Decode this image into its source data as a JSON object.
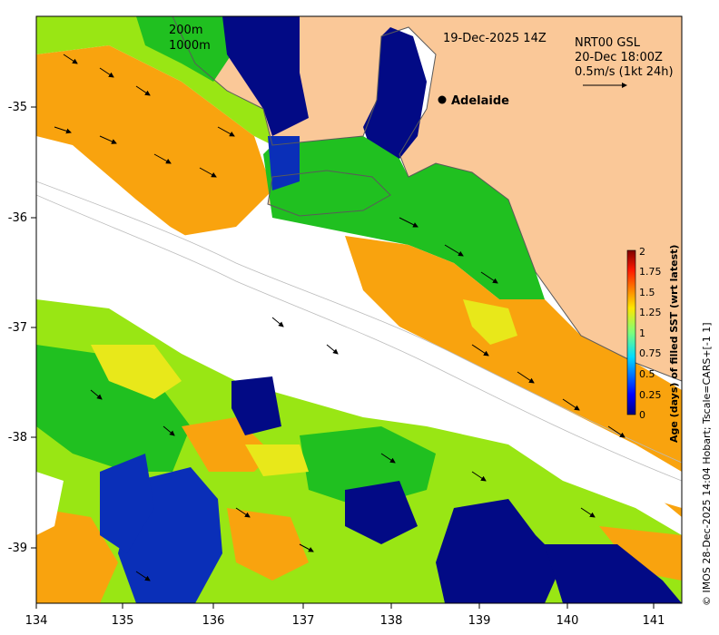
{
  "map": {
    "date_label": "19-Dec-2025 14Z",
    "product_line1": "NRT00 GSL",
    "product_line2": "20-Dec 18:00Z",
    "product_line3": "0.5m/s (1kt 24h)",
    "depth_label1": "200m",
    "depth_label2": "1000m",
    "city": "Adelaide",
    "credit": "© IMOS 28-Dec-2025 14:04 Hobart; Tscale=CARS+[-1 1]",
    "colors": {
      "land": "#fac898",
      "no_data": "#ffffff",
      "orange": "#f9a30e",
      "lime": "#99e614",
      "green": "#20c020",
      "blue": "#0a2fb8",
      "navy": "#020a85",
      "yellow": "#e8e81a"
    }
  },
  "axes": {
    "x_ticks": [
      "134",
      "135",
      "136",
      "137",
      "138",
      "139",
      "140",
      "141"
    ],
    "y_ticks": [
      "-35",
      "-36",
      "-37",
      "-38",
      "-39"
    ]
  },
  "colorbar": {
    "label": "Age (days) of filled SST (wrt latest)",
    "ticks": [
      "0",
      "0.25",
      "0.5",
      "0.75",
      "1",
      "1.25",
      "1.5",
      "1.75",
      "2"
    ],
    "range": [
      0,
      2
    ],
    "colormap": "jet"
  }
}
